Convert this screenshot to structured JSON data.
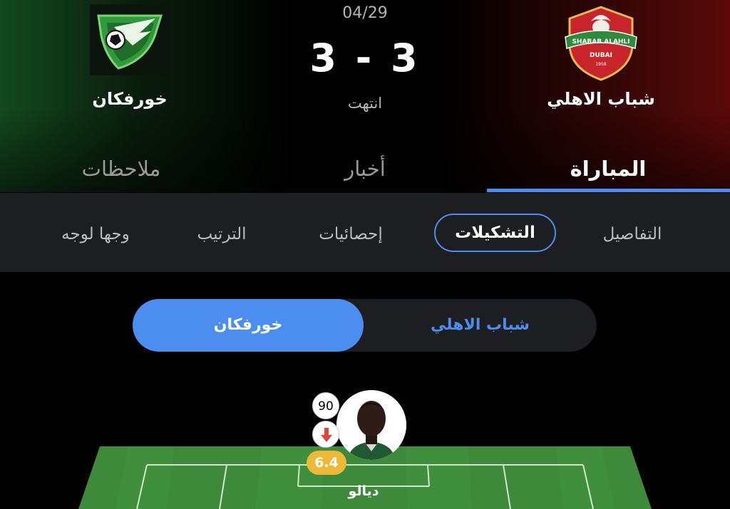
{
  "match": {
    "date": "04/29",
    "score": "3 - 3",
    "status": "انتهت"
  },
  "teams": {
    "away": {
      "name": "خورفكان",
      "logo_icon": "khorfakkan-crest-icon"
    },
    "home": {
      "name": "شباب الاهلي",
      "logo_icon": "shabab-alahli-crest-icon",
      "logo_text": "SHABAB ALAHLI",
      "logo_city": "DUBAI",
      "logo_year": "1958"
    }
  },
  "main_tabs": [
    {
      "label": "ملاحظات",
      "active": false
    },
    {
      "label": "أخبار",
      "active": false
    },
    {
      "label": "المباراة",
      "active": true
    }
  ],
  "sub_tabs": [
    {
      "label": "وجها لوجه",
      "active": false
    },
    {
      "label": "الترتيب",
      "active": false
    },
    {
      "label": "إحصائيات",
      "active": false
    },
    {
      "label": "التشكيلات",
      "active": true
    },
    {
      "label": "التفاصيل",
      "active": false
    }
  ],
  "lineup_toggle": {
    "selected": "خورفكان",
    "other": "شباب الاهلي"
  },
  "player": {
    "name": "ديالو",
    "minute": "90",
    "rating": "6.4",
    "sub_icon": "substitution-out-arrow-icon"
  },
  "colors": {
    "accent": "#4b8ef0",
    "rating": "#f0b838",
    "pitch": "#3d8a3a",
    "sub_out": "#e0443e"
  }
}
